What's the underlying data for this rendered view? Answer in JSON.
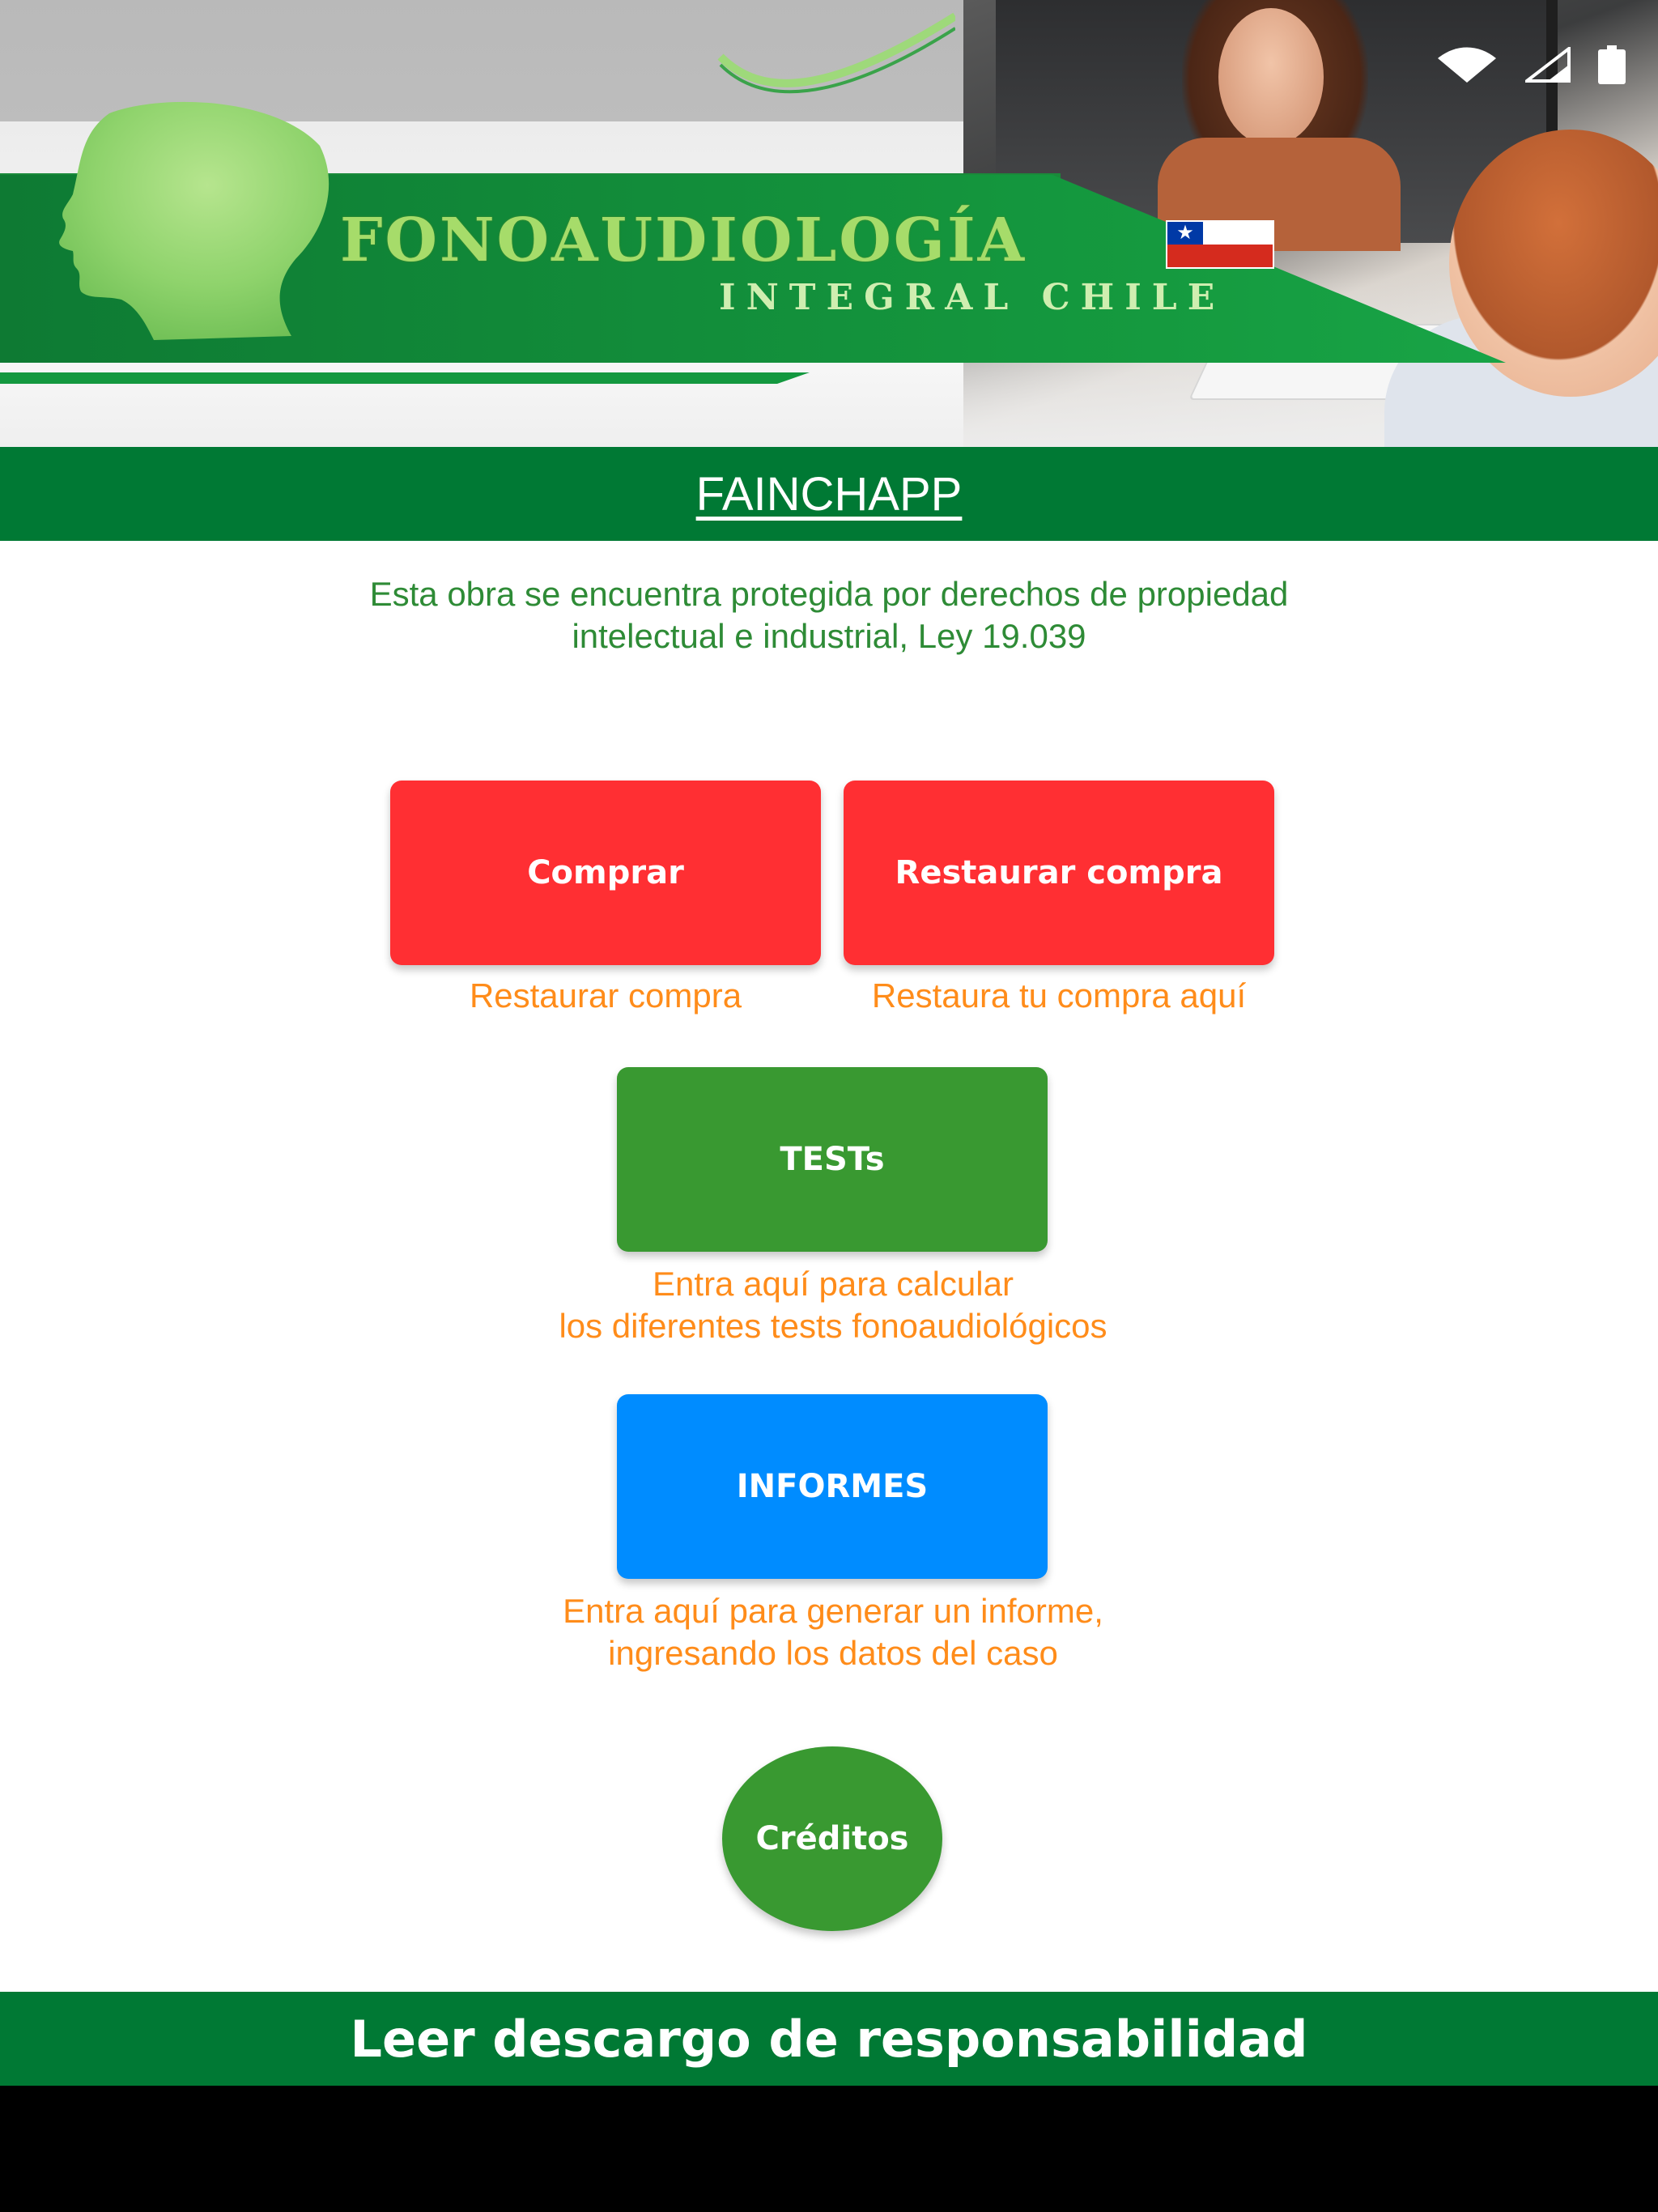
{
  "status_bar": {
    "icons": [
      "wifi-icon",
      "cell-signal-icon",
      "battery-icon"
    ]
  },
  "banner": {
    "brand_title": "FONOAUDIOLOGÍA",
    "brand_subtitle": "INTEGRAL CHILE",
    "flag": "Chile flag"
  },
  "app_bar": {
    "title": "FAINCHAPP"
  },
  "legal_notice": {
    "line1": "Esta obra se encuentra protegida por derechos de propiedad",
    "line2": "intelectual e industrial, Ley 19.039"
  },
  "buttons": {
    "comprar": {
      "label": "Comprar",
      "caption": "Restaurar compra",
      "color": "#ff2f33"
    },
    "restaurar": {
      "label": "Restaurar compra",
      "caption": "Restaura tu compra aquí",
      "color": "#ff2f33"
    },
    "tests": {
      "label": "TESTs",
      "caption_line1": "Entra aquí para calcular",
      "caption_line2": "los diferentes tests fonoaudiológicos",
      "color": "#399931"
    },
    "informes": {
      "label": "INFORMES",
      "caption_line1": "Entra aquí para generar un informe,",
      "caption_line2": "ingresando los datos del caso",
      "color": "#008cff"
    },
    "creditos": {
      "label": "Créditos",
      "color": "#399931"
    }
  },
  "footer": {
    "label": "Leer descargo de responsabilidad"
  },
  "colors": {
    "primary_green": "#007934",
    "caption_orange": "#ff8c1a",
    "legal_green": "#2e8b36"
  }
}
